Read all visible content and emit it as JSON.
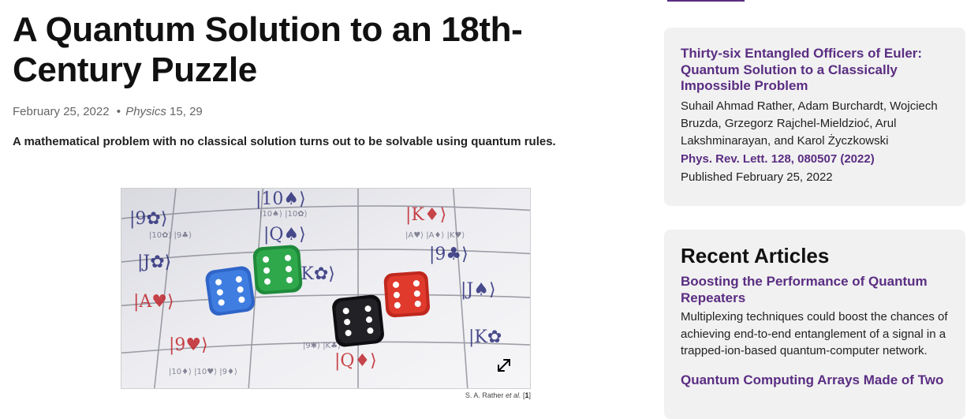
{
  "article": {
    "title": "A Quantum Solution to an 18th-Century Puzzle",
    "date": "February 25, 2022",
    "bullet": "•",
    "journal": "Physics",
    "volume": "15, 29",
    "summary": "A mathematical problem with no classical solution turns out to be solvable using quantum rules.",
    "figure_icon": "expand-icon",
    "credit_prefix": "S. A. Rather ",
    "credit_etal": "et al.",
    "credit_open": " [",
    "credit_ref": "1",
    "credit_close": "]"
  },
  "paper": {
    "title": "Thirty-six Entangled Officers of Euler: Quantum Solution to a Classically Impossible Problem",
    "authors": "Suhail Ahmad Rather, Adam Burchardt, Wojciech Bruzda, Grzegorz Rajchel-Mieldzioć, Arul Lakshminarayan, and Karol Życzkowski",
    "citation": "Phys. Rev. Lett. 128, 080507 (2022)",
    "published": "Published February 25, 2022"
  },
  "recent": {
    "heading": "Recent Articles",
    "items": [
      {
        "title": "Boosting the Performance of Quantum Repeaters",
        "blurb": "Multiplexing techniques could boost the chances of achieving end-to-end entanglement of a signal in a trapped-ion-based quantum-computer network."
      },
      {
        "title": "Quantum Computing Arrays Made of Two",
        "blurb": ""
      }
    ]
  },
  "colors": {
    "accent": "#5a2d82",
    "card_bg": "#f1f1f1",
    "text": "#1a1a1a"
  }
}
